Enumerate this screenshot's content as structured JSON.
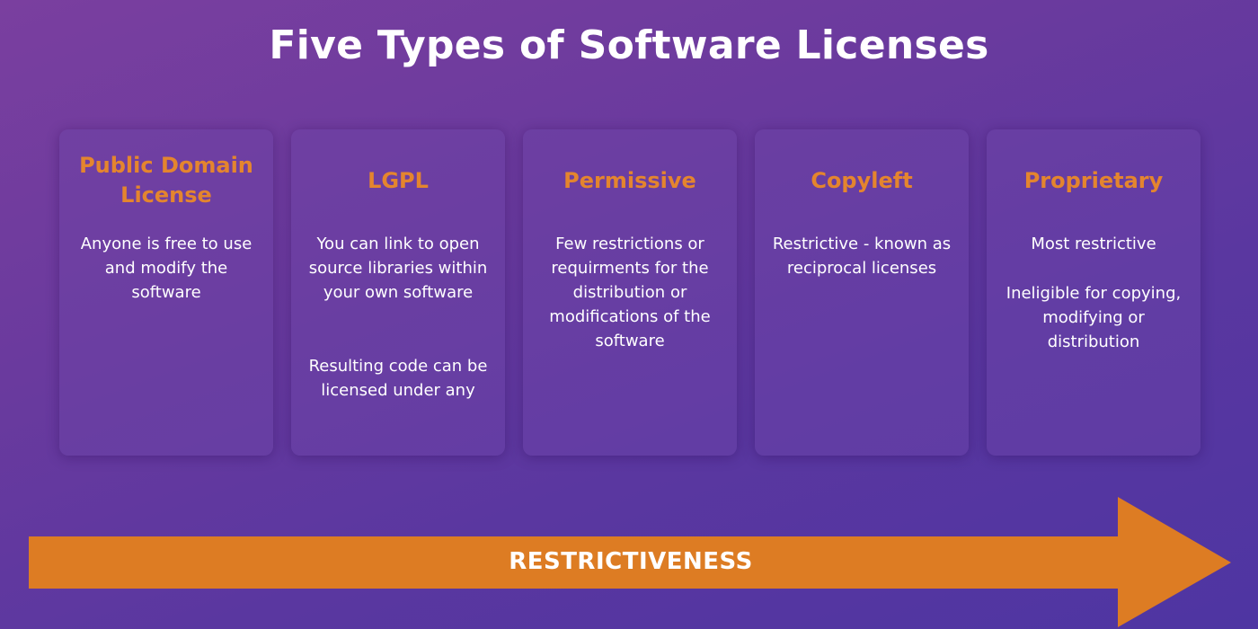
{
  "title": "Five Types of Software Licenses",
  "colors": {
    "heading": "#e4852e",
    "arrow": "#dd7c23",
    "text": "#ffffff"
  },
  "cards": [
    {
      "heading_lines": [
        "Public Domain",
        "License"
      ],
      "paragraphs": [
        "Anyone is free to use and modify the software"
      ]
    },
    {
      "heading_lines": [
        "LGPL"
      ],
      "paragraphs": [
        "You can link to open source libraries within your own software",
        "Resulting code can be licensed under any"
      ]
    },
    {
      "heading_lines": [
        "Permissive"
      ],
      "paragraphs": [
        "Few restrictions or requirments for the distribution or modifications of the software"
      ]
    },
    {
      "heading_lines": [
        "Copyleft"
      ],
      "paragraphs": [
        "Restrictive - known as reciprocal licenses"
      ]
    },
    {
      "heading_lines": [
        "Proprietary"
      ],
      "paragraphs": [
        "Most restrictive",
        "Ineligible for copying, modifying or distribution"
      ]
    }
  ],
  "arrow": {
    "label": "RESTRICTIVENESS"
  }
}
